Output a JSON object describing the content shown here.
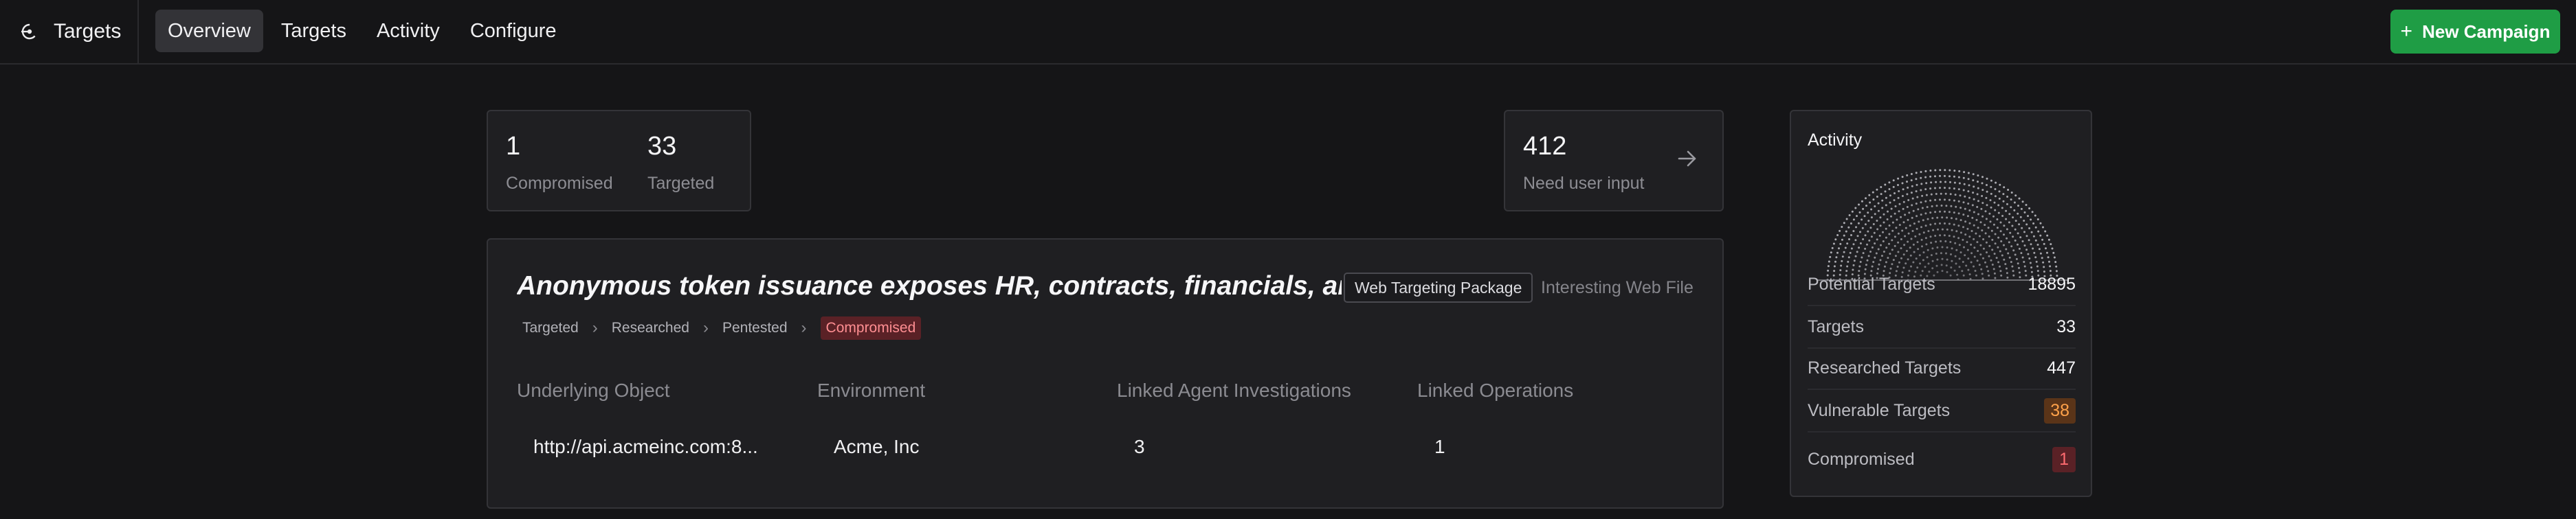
{
  "app": {
    "title": "Targets",
    "icon": "targets-logo-icon"
  },
  "nav": {
    "tabs": [
      {
        "label": "Overview",
        "active": true
      },
      {
        "label": "Targets",
        "active": false
      },
      {
        "label": "Activity",
        "active": false
      },
      {
        "label": "Configure",
        "active": false
      }
    ]
  },
  "actions": {
    "new_campaign": "New Campaign",
    "new_campaign_icon": "plus-icon",
    "accent": "#1f9d45"
  },
  "stats": {
    "compromised": {
      "value": "1",
      "label": "Compromised"
    },
    "targeted": {
      "value": "33",
      "label": "Targeted"
    },
    "need_input": {
      "value": "412",
      "label": "Need user input",
      "icon": "arrow-right-icon"
    }
  },
  "finding": {
    "title": "Anonymous token issuance exposes HR, contracts, financials, and se...",
    "tag": "Web Targeting Package",
    "secondary_tag": "Interesting Web File",
    "pipeline": [
      "Targeted",
      "Researched",
      "Pentested",
      "Compromised"
    ],
    "current_stage": "Compromised",
    "columns": [
      "Underlying Object",
      "Environment",
      "Linked Agent Investigations",
      "Linked Operations"
    ],
    "values": [
      "http://api.acmeinc.com:8...",
      "Acme, Inc",
      "3",
      "1"
    ]
  },
  "activity": {
    "title": "Activity",
    "chart": "dome-dot-chart",
    "metrics": [
      {
        "label": "Potential Targets",
        "value": "18895",
        "style": "plain"
      },
      {
        "label": "Targets",
        "value": "33",
        "style": "plain"
      },
      {
        "label": "Researched Targets",
        "value": "447",
        "style": "plain"
      },
      {
        "label": "Vulnerable Targets",
        "value": "38",
        "style": "orange",
        "color": "#ffa24a"
      },
      {
        "label": "Compromised",
        "value": "1",
        "style": "red",
        "color": "#ff6b70"
      }
    ]
  }
}
